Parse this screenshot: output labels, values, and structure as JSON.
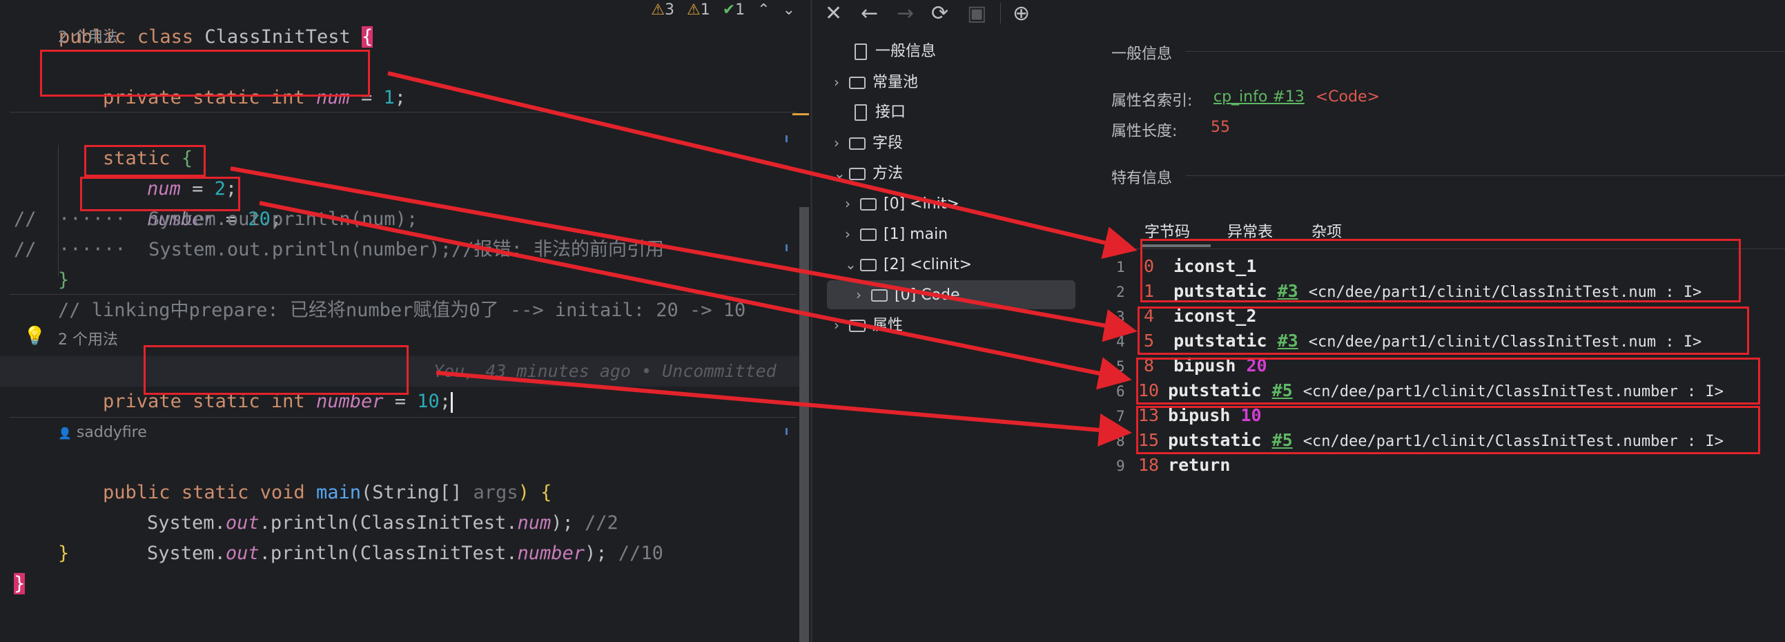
{
  "editor": {
    "inspection": {
      "warnings_a": "3",
      "warnings_b": "1",
      "ok": "1"
    },
    "line_class": {
      "kw1": "public",
      "kw2": "class",
      "name": "ClassInitTest",
      "brace": "{"
    },
    "usage_hint_1": "2 个用法",
    "decl_num": {
      "kw1": "private",
      "kw2": "static",
      "kw3": "int",
      "name": "num",
      "eq": "=",
      "val": "1",
      "semi": ";"
    },
    "static_block": {
      "kw": "static",
      "brace": "{"
    },
    "assign_num": {
      "name": "num",
      "eq": "=",
      "val": "2",
      "semi": ";"
    },
    "assign_number": {
      "name": "number",
      "eq": "=",
      "val": "20",
      "semi": ";"
    },
    "commented_1": "//  ······  System.out.println(num);",
    "commented_2": "//  ······  System.out.println(number);//报错: 非法的前向引用",
    "close_static": "}",
    "linking_comment": "// linking中prepare: 已经将number赋值为0了 --> initail: 20 -> 10",
    "usage_hint_2": "2 个用法",
    "decl_number": {
      "kw1": "private",
      "kw2": "static",
      "kw3": "int",
      "name": "number",
      "eq": "=",
      "val": "10",
      "semi": ";"
    },
    "blame": "You, 43 minutes ago • Uncommitted",
    "author_hint": "saddyfire",
    "main_sig": {
      "kw1": "public",
      "kw2": "static",
      "kw3": "void",
      "fn": "main",
      "params": "(String[] ",
      "arg": "args",
      "close": ") {"
    },
    "println_1": {
      "prefix": "System.",
      "out": "out",
      "mid": ".println(ClassInitTest.",
      "field": "num",
      "end": ");",
      "comment": " //2"
    },
    "println_2": {
      "prefix": "System.",
      "out": "out",
      "mid": ".println(ClassInitTest.",
      "field": "number",
      "end": ");",
      "comment": " //10"
    },
    "close_main": "}",
    "close_class": "}"
  },
  "viewer": {
    "tree": [
      {
        "label": "一般信息",
        "kind": "file"
      },
      {
        "label": "常量池",
        "kind": "folder"
      },
      {
        "label": "接口",
        "kind": "file"
      },
      {
        "label": "字段",
        "kind": "folder"
      },
      {
        "label": "方法",
        "kind": "folder"
      },
      {
        "label": "[0] <init>",
        "kind": "folder"
      },
      {
        "label": "[1] main",
        "kind": "folder"
      },
      {
        "label": "[2] <clinit>",
        "kind": "folder"
      },
      {
        "label": "[0] Code",
        "kind": "folder"
      },
      {
        "label": "属性",
        "kind": "folder"
      }
    ],
    "general_title": "一般信息",
    "attr_name_label": "属性名索引:",
    "attr_name_link": "cp_info #13",
    "attr_name_value": "<Code>",
    "attr_len_label": "属性长度:",
    "attr_len_value": "55",
    "specific_title": "特有信息",
    "tabs": [
      "字节码",
      "异常表",
      "杂项"
    ],
    "bytecode": [
      {
        "ln": "1",
        "off": "0",
        "op": "iconst_1",
        "ref": "",
        "val": "",
        "desc": ""
      },
      {
        "ln": "2",
        "off": "1",
        "op": "putstatic",
        "ref": "#3",
        "val": "",
        "desc": "<cn/dee/part1/clinit/ClassInitTest.num : I>"
      },
      {
        "ln": "3",
        "off": "4",
        "op": "iconst_2",
        "ref": "",
        "val": "",
        "desc": ""
      },
      {
        "ln": "4",
        "off": "5",
        "op": "putstatic",
        "ref": "#3",
        "val": "",
        "desc": "<cn/dee/part1/clinit/ClassInitTest.num : I>"
      },
      {
        "ln": "5",
        "off": "8",
        "op": "bipush",
        "ref": "",
        "val": "20",
        "desc": ""
      },
      {
        "ln": "6",
        "off": "10",
        "op": "putstatic",
        "ref": "#5",
        "val": "",
        "desc": "<cn/dee/part1/clinit/ClassInitTest.number : I>"
      },
      {
        "ln": "7",
        "off": "13",
        "op": "bipush",
        "ref": "",
        "val": "10",
        "desc": ""
      },
      {
        "ln": "8",
        "off": "15",
        "op": "putstatic",
        "ref": "#5",
        "val": "",
        "desc": "<cn/dee/part1/clinit/ClassInitTest.number : I>"
      },
      {
        "ln": "9",
        "off": "18",
        "op": "return",
        "ref": "",
        "val": "",
        "desc": ""
      }
    ]
  },
  "colors": {
    "annotation": "#e3232b",
    "keyword": "#cf8e6d",
    "field": "#c77dbb",
    "number": "#2aacb8"
  }
}
